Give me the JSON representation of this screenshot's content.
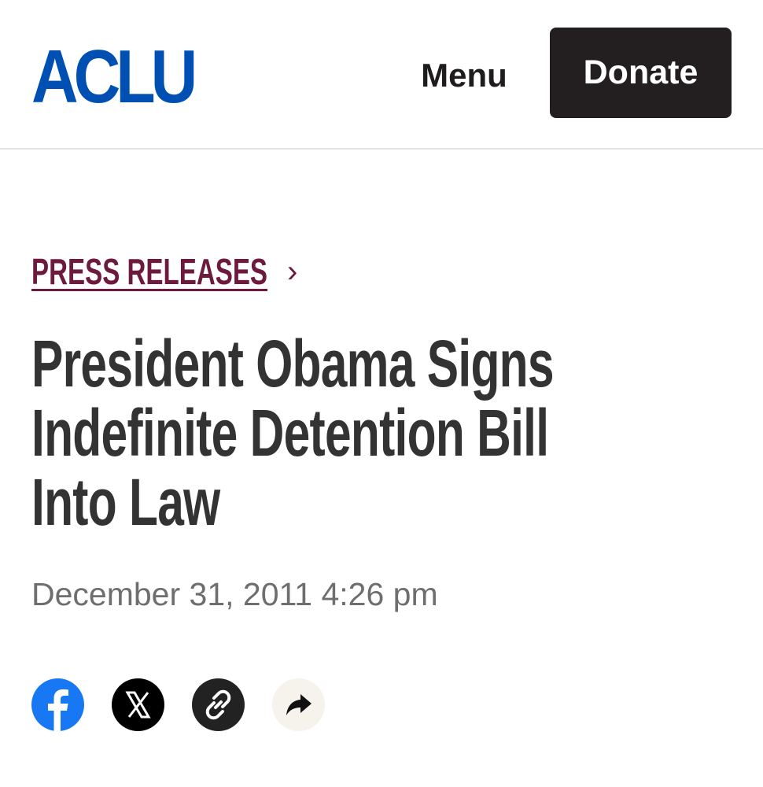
{
  "header": {
    "logo_text": "ACLU",
    "menu_label": "Menu",
    "donate_label": "Donate"
  },
  "breadcrumb": {
    "label": "PRESS RELEASES",
    "separator": "›"
  },
  "article": {
    "title": "President Obama Signs Indefinite Detention Bill Into Law",
    "date": "December 31, 2011 4:26 pm"
  },
  "share": {
    "icons": [
      "facebook-icon",
      "x-icon",
      "copy-link-icon",
      "share-icon"
    ]
  },
  "colors": {
    "brand_blue": "#0050b4",
    "breadcrumb": "#6d1a3e",
    "donate_bg": "#231f20",
    "facebook": "#1877f2"
  }
}
